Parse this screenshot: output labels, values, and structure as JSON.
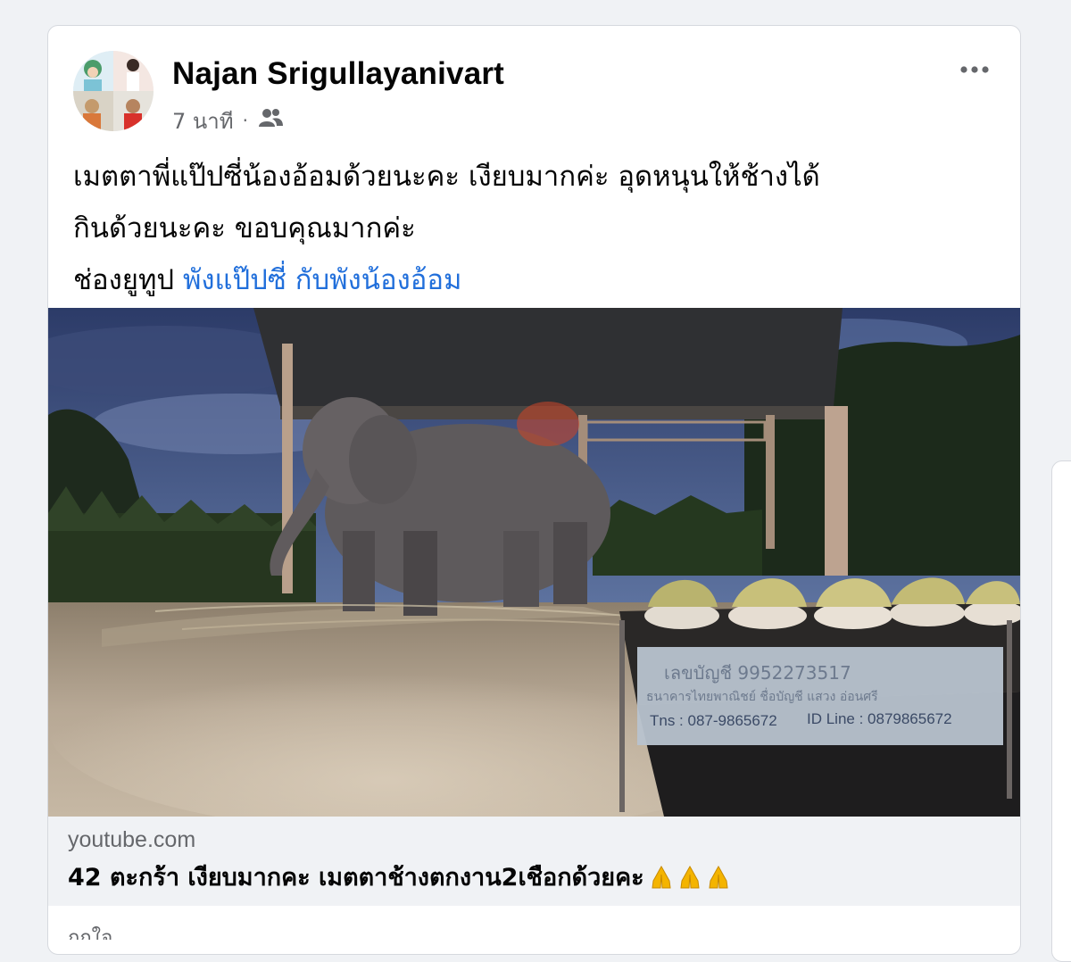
{
  "post": {
    "author": "Najan Srigullayanivart",
    "timestamp": "7 นาที",
    "separator": "·",
    "audience_icon": "friends-icon",
    "more_icon": "more-horizontal-icon",
    "text_line1": "เมตตาพี่แป๊ปซี่น้องอ้อมด้วยนะคะ เงียบมากค่ะ อุดหนุนให้ช้างได้",
    "text_line2": "กินด้วยนะคะ ขอบคุณมากค่ะ",
    "text_line3_prefix": "ช่องยูทูป ",
    "text_line3_link": "พังแป๊ปซี่ กับพังน้องอ้อม",
    "link_color": "#216fdb"
  },
  "photo": {
    "sign_line1": "เลขบัญชี 9952273517",
    "sign_line2": "ธนาคารไทยพาณิชย์ ชื่อบัญชี แสวง อ่อนศรี",
    "sign_tel": "Tns : 087-9865672",
    "sign_line": "ID Line : 0879865672"
  },
  "link_preview": {
    "domain": "youtube.com",
    "title": "42 ตะกร้า เงียบมากคะ เมตตาช้างตกงาน2เชือกด้วยคะ",
    "emoji_icon": "folded-hands-icon"
  },
  "footer": {
    "peek_text": "ถูกใจ"
  }
}
